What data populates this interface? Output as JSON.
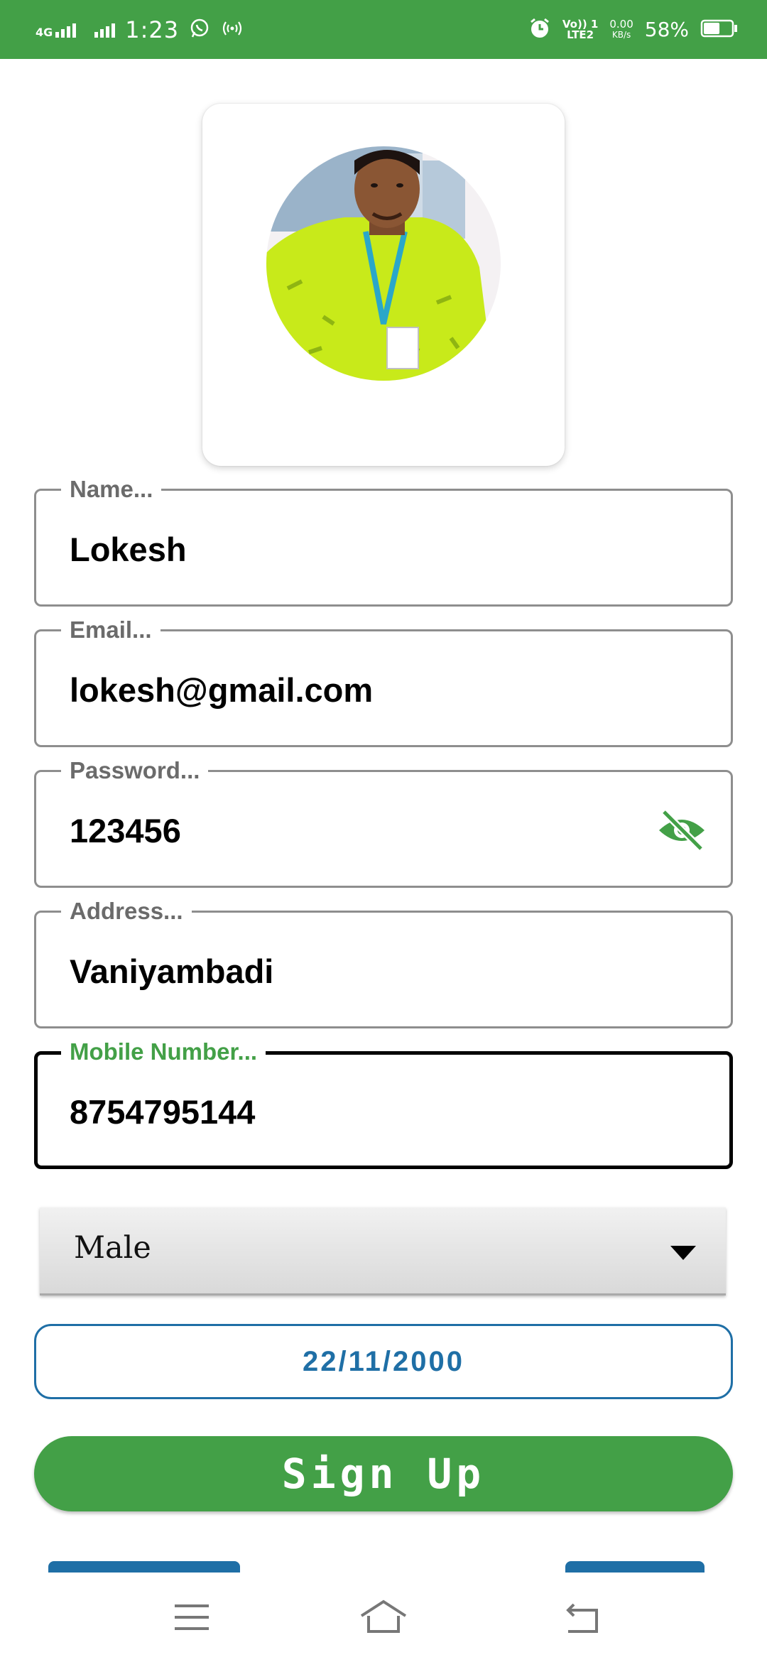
{
  "status_bar": {
    "network": "4G",
    "time": "1:23",
    "volte_line1": "Vo)) 1",
    "volte_line2": "LTE2",
    "speed_value": "0.00",
    "speed_unit": "KB/s",
    "battery_percent": "58%",
    "battery_level": 0.58,
    "icons": [
      "network-icon",
      "signal-icon",
      "whatsapp-icon",
      "hotspot-icon",
      "alarm-icon",
      "battery-icon"
    ]
  },
  "profile": {
    "avatar_icon": "profile-photo"
  },
  "form": {
    "name": {
      "label": "Name...",
      "value": "Lokesh"
    },
    "email": {
      "label": "Email...",
      "value": "lokesh@gmail.com"
    },
    "password": {
      "label": "Password...",
      "value": "123456",
      "toggle_icon": "eye-off-icon"
    },
    "address": {
      "label": "Address...",
      "value": "Vaniyambadi"
    },
    "mobile": {
      "label": "Mobile Number...",
      "value": "8754795144"
    },
    "gender": {
      "selected": "Male"
    },
    "dob": {
      "value": "22/11/2000"
    },
    "signup_label": "Sign Up"
  },
  "colors": {
    "primary_green": "#43a047",
    "link_blue": "#1f6fa6",
    "field_border": "#8e8e8e",
    "focused_border": "#000000"
  },
  "nav_bar": {
    "icons": [
      "menu-icon",
      "home-icon",
      "back-icon"
    ]
  }
}
